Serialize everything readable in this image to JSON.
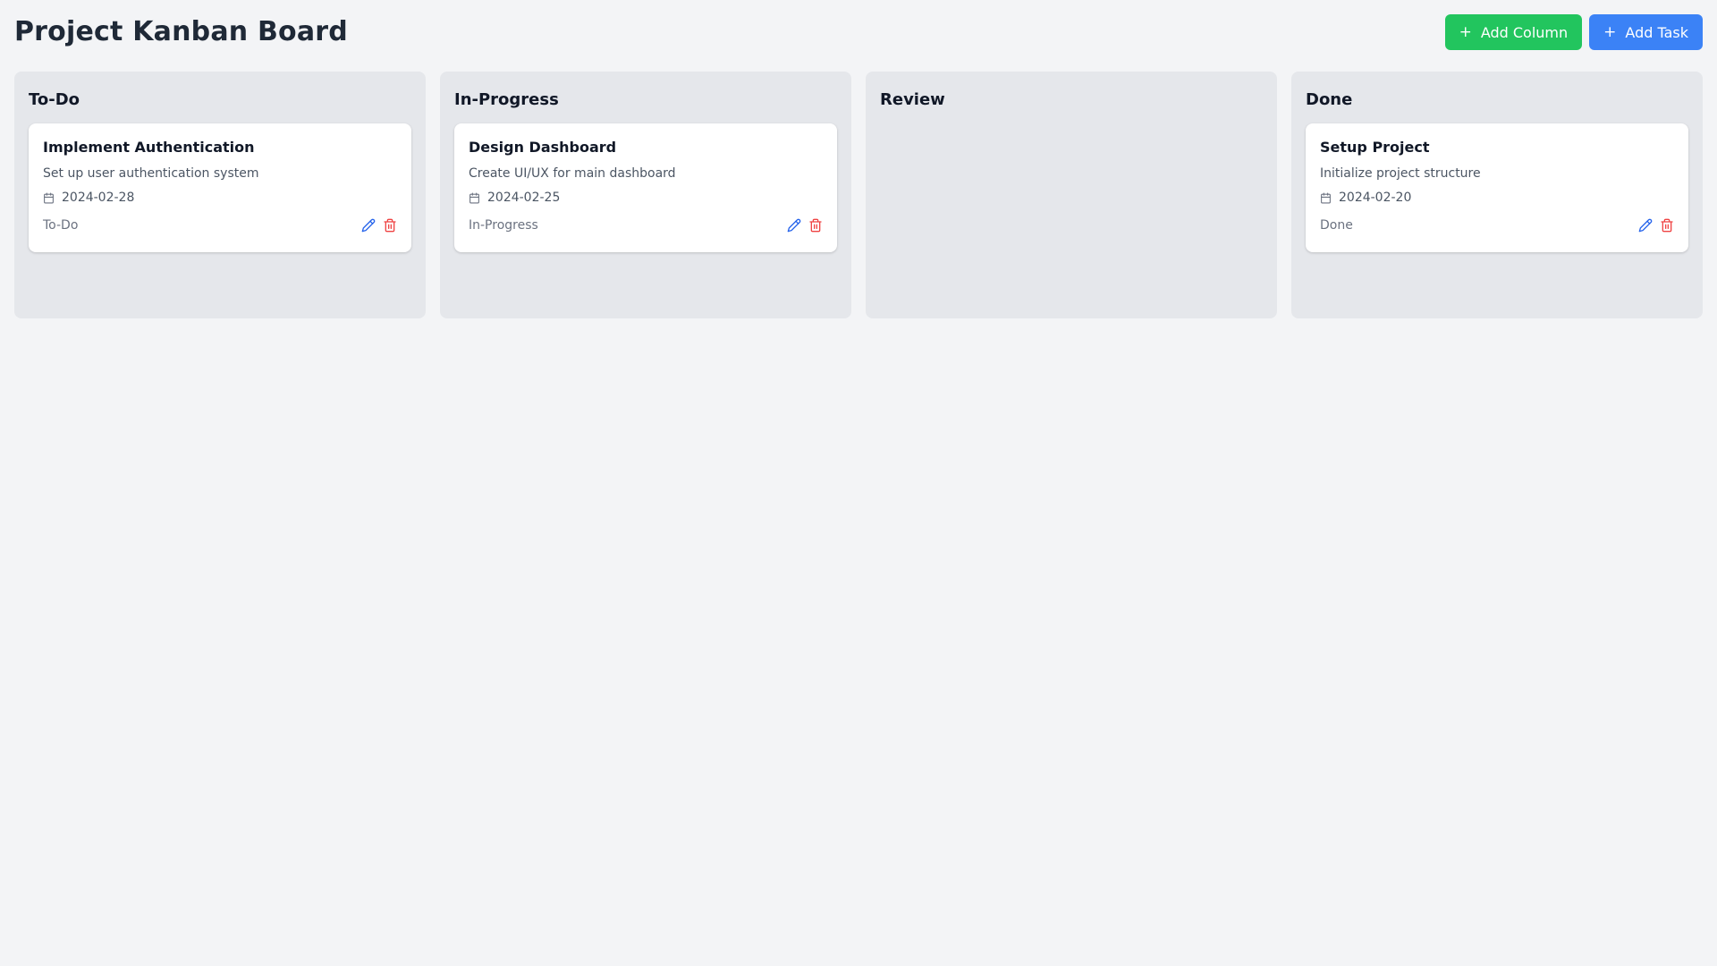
{
  "header": {
    "title": "Project Kanban Board",
    "add_column_label": "Add Column",
    "add_task_label": "Add Task",
    "plus_icon": "plus-icon",
    "add_column_color": "#22c55e",
    "add_task_color": "#3b82f6"
  },
  "columns": [
    {
      "title": "To-Do",
      "cards": [
        {
          "title": "Implement Authentication",
          "description": "Set up user authentication system",
          "date": "2024-02-28",
          "status": "To-Do"
        }
      ]
    },
    {
      "title": "In-Progress",
      "cards": [
        {
          "title": "Design Dashboard",
          "description": "Create UI/UX for main dashboard",
          "date": "2024-02-25",
          "status": "In-Progress"
        }
      ]
    },
    {
      "title": "Review",
      "cards": []
    },
    {
      "title": "Done",
      "cards": [
        {
          "title": "Setup Project",
          "description": "Initialize project structure",
          "date": "2024-02-20",
          "status": "Done"
        }
      ]
    }
  ],
  "icons": {
    "date": "calendar-icon",
    "edit": "pencil-icon",
    "delete": "trash-icon",
    "edit_color": "#2563eb",
    "delete_color": "#ef4444"
  }
}
